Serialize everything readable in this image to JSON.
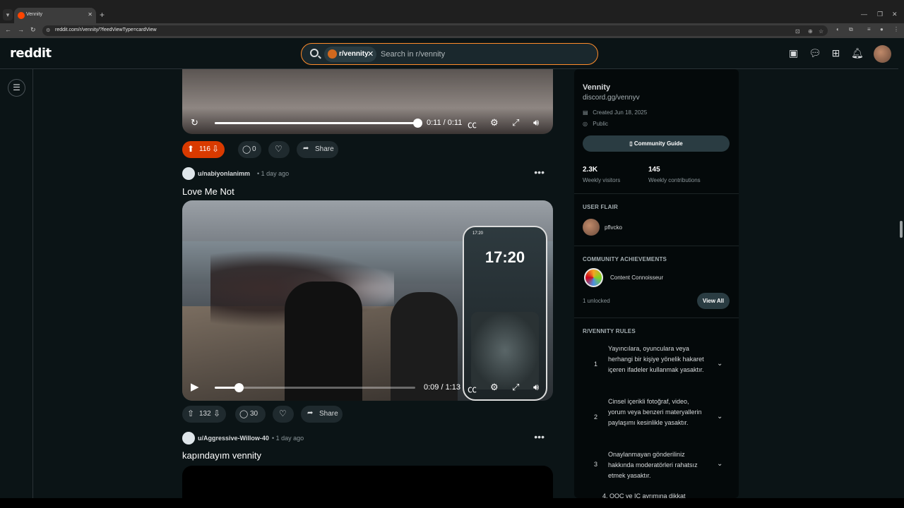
{
  "browser": {
    "tab_title": "Vennity",
    "url": "reddit.com/r/vennity/?feedViewType=cardView"
  },
  "header": {
    "logo": "reddit",
    "community_chip": "r/vennity",
    "search_placeholder": "Search in r/vennity"
  },
  "feed": {
    "post1": {
      "video_time": "0:11 / 0:11",
      "upvotes": "116",
      "comments": "0",
      "share": "Share"
    },
    "post2": {
      "username": "u/nabiyonlanimm",
      "time": "• 1 day ago",
      "title": "Love Me Not",
      "video_time": "0:09 / 1:13",
      "progress": 0.12,
      "phone_clock": "17:20",
      "upvotes": "132",
      "comments": "30",
      "share": "Share"
    },
    "post3": {
      "username": "u/Aggressive-Willow-40",
      "time": "• 1 day ago",
      "title": "kapındayım vennity"
    }
  },
  "sidebar": {
    "name": "Vennity",
    "link": "discord.gg/vennyv",
    "created": "Created Jun 18, 2025",
    "visibility": "Public",
    "guide_button": "Community Guide",
    "visitors_count": "2.3K",
    "visitors_label": "Weekly visitors",
    "contrib_count": "145",
    "contrib_label": "Weekly contributions",
    "flair_heading": "USER FLAIR",
    "flair_user": "pflvcko",
    "achievements_heading": "COMMUNITY ACHIEVEMENTS",
    "achievement": "Content Connoisseur",
    "unlocked": "1 unlocked",
    "view_all": "View All",
    "rules_heading": "R/VENNITY RULES",
    "rules": [
      {
        "num": "1",
        "text": "Yayıncılara, oyunculara veya herhangi bir kişiye yönelik hakaret içeren ifadeler kullanmak yasaktır."
      },
      {
        "num": "2",
        "text": "Cinsel içerikli fotoğraf, video, yorum veya benzeri materyallerin paylaşımı kesinlikle yasaktır."
      },
      {
        "num": "3",
        "text": "Onaylanmayan gönderiliniz hakkında moderatörleri rahatsız etmek yasaktır."
      }
    ],
    "rule4_partial": "4. OOC ve IC ayrımına dikkat"
  }
}
